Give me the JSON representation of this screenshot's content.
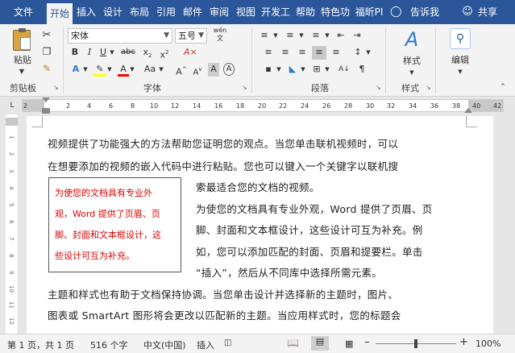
{
  "tabs": [
    "文件",
    "开始",
    "插入",
    "设计",
    "布局",
    "引用",
    "邮件",
    "审阅",
    "视图",
    "开发工",
    "帮助",
    "特色功",
    "福昕PI"
  ],
  "tell_me": "告诉我",
  "share": "共享",
  "clipboard": {
    "paste": "粘贴",
    "group": "剪贴板"
  },
  "font": {
    "name": "宋体",
    "size": "五号",
    "group": "字体",
    "wen": "wén",
    "a_box": "A"
  },
  "paragraph": {
    "group": "段落"
  },
  "styles": {
    "label": "样式",
    "group": "样式"
  },
  "editing": {
    "label": "编辑"
  },
  "ruler": {
    "ticks": [
      "2",
      "2",
      "4",
      "6",
      "8",
      "10",
      "12",
      "14",
      "16",
      "18",
      "20",
      "22",
      "24",
      "26",
      "28",
      "30",
      "32",
      "34",
      "36",
      "38",
      "40",
      "42"
    ]
  },
  "vruler": {
    "ticks": [
      "1",
      "2",
      "3",
      "4",
      "5",
      "6",
      "7",
      "8",
      "9",
      "10",
      "11",
      "12"
    ]
  },
  "document": {
    "lines": [
      "视频提供了功能强大的方法帮助您证明您的观点。当您单击联机视频时，可以",
      "在想要添加的视频的嵌入代码中进行粘贴。您也可以键入一个关键字以联机搜",
      "索最适合您的文档的视频。",
      "为使您的文档具有专业外观，Word 提供了页眉、页",
      "脚、封面和文本框设计，这些设计可互为补充。例",
      "如，您可以添加匹配的封面、页眉和提要栏。单击",
      "“插入”，然后从不同库中选择所需元素。",
      "主题和样式也有助于文档保持协调。当您单击设计并选择新的主题时，图片、",
      "图表或 SmartArt 图形将会更改以匹配新的主题。当应用样式时，您的标题会"
    ],
    "textbox_lines": [
      "为使您的文档具有专业外",
      "观，Word 提供了页眉、页",
      "脚、封面和文本框设计，这",
      "些设计可互为补充。"
    ]
  },
  "status": {
    "page": "第 1 页，共 1 页",
    "words": "516 个字",
    "lang": "中文(中国)",
    "mode": "插入",
    "zoom": "100%"
  },
  "colors": {
    "accent": "#2b579a",
    "textbox_text": "#dd0000",
    "highlight": "#ffff00",
    "font_color": "#ff0000"
  }
}
